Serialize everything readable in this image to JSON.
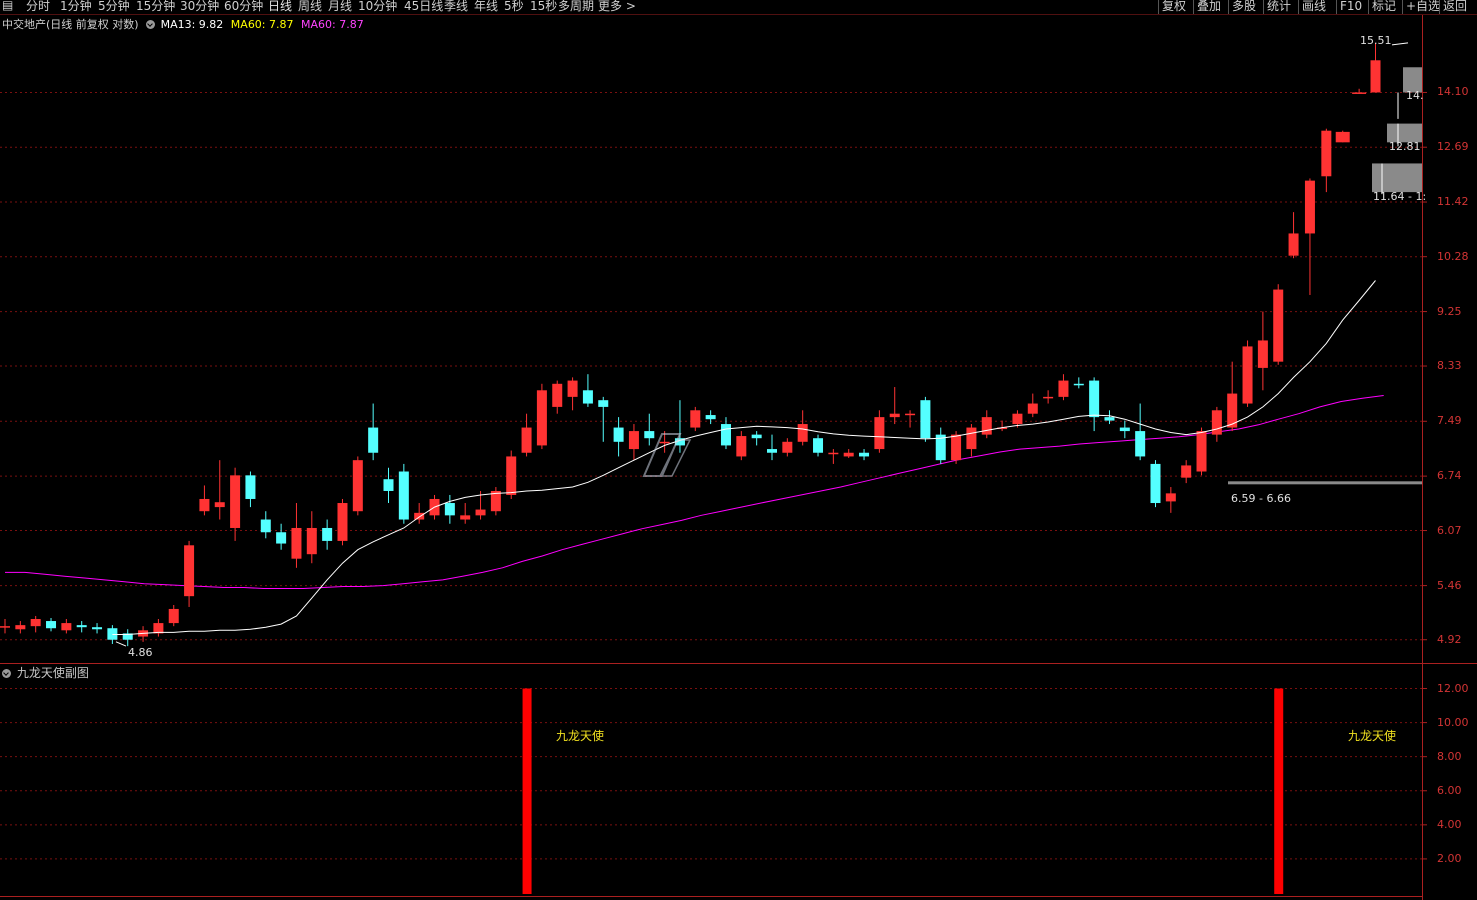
{
  "toolbar": {
    "left_icon": "collapse-icon",
    "periods": [
      "分时",
      "1分钟",
      "5分钟",
      "15分钟",
      "30分钟",
      "60分钟",
      "日线",
      "周线",
      "月线",
      "10分钟",
      "45日线",
      "季线",
      "年线",
      "5秒",
      "15秒",
      "多周期",
      "更多 >"
    ],
    "active_period": "日线",
    "right_buttons": [
      "复权",
      "叠加",
      "多股",
      "统计",
      "画线",
      "F10",
      "标记",
      "+自选",
      "返回"
    ]
  },
  "main_legend": {
    "title": "中交地产(日线 前复权 对数)",
    "ma13": "MA13: 9.82",
    "ma60a": "MA60: 7.87",
    "ma60b": "MA60: 7.87",
    "colors": {
      "ma13": "#ffffff",
      "ma60a": "#ffff00",
      "ma60b": "#ff00ff"
    }
  },
  "sub_legend": {
    "title": "九龙天使副图",
    "signal_label": "九龙天使"
  },
  "annotations": {
    "low_label": "4.86",
    "high_label": "15.51",
    "level_1410": "14.",
    "level_1281": "12.81",
    "range_1164": "11.64 - 1:",
    "range_659": "6.59 - 6.66"
  },
  "colors": {
    "up": "#ff3333",
    "down": "#54ffff",
    "ma13": "#ffffff",
    "ma60": "#ff00ff",
    "grid": "#7a1010",
    "axis_text": "#d23434",
    "signal_bar": "#ff0000",
    "signal_text": "#f0e020"
  },
  "chart_data": [
    {
      "type": "candlestick",
      "title": "中交地产(日线 前复权 对数)",
      "y_scale": "log",
      "y_ticks": [
        4.92,
        5.46,
        6.07,
        6.74,
        7.49,
        8.33,
        9.25,
        10.28,
        11.42,
        12.69,
        14.1
      ],
      "y_tick_labels": [
        "4.92",
        "5.46",
        "6.07",
        "6.74",
        "7.49",
        "8.33",
        "9.25",
        "10.28",
        "11.42",
        "12.69",
        "14.10"
      ],
      "ylim": [
        4.75,
        15.9
      ],
      "grid": true,
      "candles": [
        [
          5.05,
          5.05,
          5.12,
          4.98
        ],
        [
          5.02,
          5.06,
          5.1,
          4.98
        ],
        [
          5.05,
          5.12,
          5.15,
          4.99
        ],
        [
          5.1,
          5.03,
          5.13,
          5.0
        ],
        [
          5.01,
          5.08,
          5.12,
          4.98
        ],
        [
          5.06,
          5.04,
          5.1,
          4.99
        ],
        [
          5.04,
          5.02,
          5.08,
          4.98
        ],
        [
          5.03,
          4.92,
          5.06,
          4.88
        ],
        [
          4.98,
          4.92,
          5.02,
          4.86
        ],
        [
          4.95,
          5.01,
          5.05,
          4.9
        ],
        [
          4.98,
          5.08,
          5.12,
          4.95
        ],
        [
          5.08,
          5.22,
          5.26,
          5.05
        ],
        [
          5.35,
          5.9,
          5.95,
          5.24
        ],
        [
          6.3,
          6.45,
          6.62,
          6.25
        ],
        [
          6.35,
          6.41,
          6.95,
          6.2
        ],
        [
          6.1,
          6.75,
          6.85,
          5.95
        ],
        [
          6.75,
          6.45,
          6.8,
          6.35
        ],
        [
          6.2,
          6.05,
          6.3,
          5.98
        ],
        [
          6.05,
          5.92,
          6.15,
          5.85
        ],
        [
          5.75,
          6.1,
          6.4,
          5.65
        ],
        [
          5.8,
          6.1,
          6.3,
          5.7
        ],
        [
          6.1,
          5.95,
          6.2,
          5.85
        ],
        [
          5.95,
          6.4,
          6.45,
          5.9
        ],
        [
          6.3,
          6.95,
          7.0,
          6.25
        ],
        [
          7.4,
          7.05,
          7.75,
          6.95
        ],
        [
          6.7,
          6.55,
          6.85,
          6.4
        ],
        [
          6.8,
          6.2,
          6.9,
          6.15
        ],
        [
          6.2,
          6.28,
          6.4,
          6.15
        ],
        [
          6.25,
          6.45,
          6.5,
          6.2
        ],
        [
          6.4,
          6.25,
          6.5,
          6.15
        ],
        [
          6.2,
          6.25,
          6.4,
          6.15
        ],
        [
          6.25,
          6.32,
          6.55,
          6.2
        ],
        [
          6.3,
          6.55,
          6.6,
          6.25
        ],
        [
          6.5,
          7.0,
          7.08,
          6.45
        ],
        [
          7.05,
          7.4,
          7.6,
          7.0
        ],
        [
          7.15,
          7.95,
          8.05,
          7.1
        ],
        [
          7.7,
          8.05,
          8.1,
          7.6
        ],
        [
          7.85,
          8.1,
          8.15,
          7.65
        ],
        [
          7.95,
          7.75,
          8.2,
          7.7
        ],
        [
          7.8,
          7.7,
          7.85,
          7.2
        ],
        [
          7.4,
          7.2,
          7.55,
          7.0
        ],
        [
          7.1,
          7.35,
          7.45,
          6.95
        ],
        [
          7.35,
          7.25,
          7.6,
          7.15
        ],
        [
          7.2,
          7.2,
          7.35,
          7.05
        ],
        [
          7.25,
          7.15,
          7.8,
          7.05
        ],
        [
          7.4,
          7.65,
          7.7,
          7.35
        ],
        [
          7.58,
          7.52,
          7.65,
          7.45
        ],
        [
          7.45,
          7.15,
          7.55,
          7.1
        ],
        [
          7.0,
          7.28,
          7.35,
          6.95
        ],
        [
          7.3,
          7.25,
          7.35,
          7.15
        ],
        [
          7.1,
          7.05,
          7.3,
          6.95
        ],
        [
          7.05,
          7.2,
          7.25,
          7.0
        ],
        [
          7.2,
          7.45,
          7.65,
          7.15
        ],
        [
          7.25,
          7.05,
          7.3,
          7.0
        ],
        [
          7.05,
          7.05,
          7.1,
          6.9
        ],
        [
          7.0,
          7.05,
          7.1,
          6.98
        ],
        [
          7.05,
          7.0,
          7.1,
          6.95
        ],
        [
          7.1,
          7.55,
          7.65,
          7.05
        ],
        [
          7.55,
          7.6,
          8.0,
          7.45
        ],
        [
          7.6,
          7.6,
          7.65,
          7.4
        ],
        [
          7.8,
          7.25,
          7.85,
          7.2
        ],
        [
          7.3,
          6.95,
          7.4,
          6.9
        ],
        [
          6.95,
          7.3,
          7.35,
          6.9
        ],
        [
          7.1,
          7.4,
          7.45,
          7.0
        ],
        [
          7.3,
          7.55,
          7.65,
          7.25
        ],
        [
          7.4,
          7.4,
          7.5,
          7.35
        ],
        [
          7.45,
          7.6,
          7.65,
          7.4
        ],
        [
          7.6,
          7.75,
          7.9,
          7.55
        ],
        [
          7.85,
          7.85,
          7.95,
          7.75
        ],
        [
          7.85,
          8.1,
          8.2,
          7.8
        ],
        [
          8.05,
          8.03,
          8.15,
          7.98
        ],
        [
          8.1,
          7.55,
          8.15,
          7.35
        ],
        [
          7.55,
          7.5,
          7.65,
          7.45
        ],
        [
          7.4,
          7.35,
          7.5,
          7.25
        ],
        [
          7.35,
          7.0,
          7.75,
          6.95
        ],
        [
          6.9,
          6.4,
          6.95,
          6.35
        ],
        [
          6.42,
          6.52,
          6.6,
          6.28
        ],
        [
          6.72,
          6.88,
          6.95,
          6.65
        ],
        [
          6.8,
          7.35,
          7.4,
          6.75
        ],
        [
          7.3,
          7.65,
          7.7,
          7.2
        ],
        [
          7.4,
          7.9,
          8.4,
          7.35
        ],
        [
          7.75,
          8.65,
          8.75,
          7.7
        ],
        [
          8.3,
          8.75,
          9.25,
          7.95
        ],
        [
          8.4,
          9.65,
          9.75,
          8.35
        ],
        [
          10.3,
          10.75,
          11.2,
          10.25
        ],
        [
          10.75,
          11.9,
          11.95,
          9.55
        ],
        [
          12.0,
          13.1,
          13.15,
          11.64
        ],
        [
          12.81,
          13.07,
          13.1,
          12.81
        ],
        [
          14.1,
          14.1,
          14.2,
          14.1
        ],
        [
          14.1,
          15.0,
          15.51,
          14.1
        ]
      ],
      "ma13": [
        4.97,
        4.97,
        4.98,
        4.99,
        4.99,
        5.0,
        5.0,
        5.01,
        5.01,
        5.02,
        5.04,
        5.07,
        5.15,
        5.33,
        5.52,
        5.7,
        5.85,
        5.94,
        6.02,
        6.1,
        6.23,
        6.35,
        6.42,
        6.47,
        6.5,
        6.52,
        6.53,
        6.55,
        6.56,
        6.58,
        6.6,
        6.66,
        6.75,
        6.85,
        6.95,
        7.05,
        7.15,
        7.22,
        7.28,
        7.33,
        7.38,
        7.4,
        7.42,
        7.41,
        7.4,
        7.38,
        7.34,
        7.31,
        7.29,
        7.28,
        7.27,
        7.26,
        7.25,
        7.24,
        7.25,
        7.28,
        7.32,
        7.36,
        7.4,
        7.43,
        7.45,
        7.48,
        7.52,
        7.56,
        7.58,
        7.57,
        7.52,
        7.45,
        7.38,
        7.33,
        7.3,
        7.33,
        7.38,
        7.45,
        7.55,
        7.7,
        7.9,
        8.15,
        8.4,
        8.7,
        9.1,
        9.45,
        9.82
      ],
      "ma60": [
        5.6,
        5.6,
        5.58,
        5.56,
        5.54,
        5.52,
        5.5,
        5.48,
        5.47,
        5.46,
        5.45,
        5.44,
        5.44,
        5.43,
        5.43,
        5.43,
        5.44,
        5.45,
        5.45,
        5.46,
        5.48,
        5.5,
        5.52,
        5.56,
        5.6,
        5.65,
        5.72,
        5.78,
        5.85,
        5.91,
        5.97,
        6.03,
        6.09,
        6.14,
        6.19,
        6.25,
        6.3,
        6.35,
        6.4,
        6.45,
        6.5,
        6.55,
        6.6,
        6.66,
        6.72,
        6.78,
        6.84,
        6.9,
        6.96,
        7.01,
        7.06,
        7.1,
        7.12,
        7.14,
        7.17,
        7.19,
        7.21,
        7.23,
        7.25,
        7.27,
        7.3,
        7.34,
        7.38,
        7.44,
        7.52,
        7.6,
        7.7,
        7.78,
        7.83,
        7.87
      ]
    },
    {
      "type": "bar",
      "title": "九龙天使副图",
      "y_ticks": [
        2,
        4,
        6,
        8,
        10,
        12
      ],
      "y_tick_labels": [
        "2.00",
        "4.00",
        "6.00",
        "8.00",
        "10.00",
        "12.00"
      ],
      "ylim": [
        0,
        12.5
      ],
      "signals": [
        {
          "candle_index": 34,
          "value": 12
        },
        {
          "candle_index": 83,
          "value": 12
        }
      ],
      "signal_label": "九龙天使"
    }
  ]
}
